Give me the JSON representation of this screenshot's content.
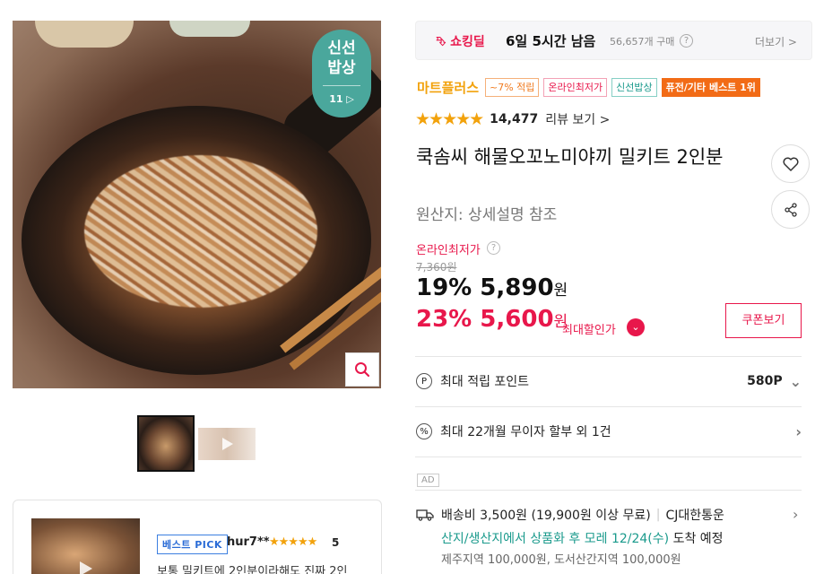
{
  "gallery": {
    "fresh_badge_top": "신선",
    "fresh_badge_bottom": "밥상",
    "fresh_badge_sub": "11",
    "zoom_icon": "search-icon"
  },
  "review_preview": {
    "badge": "베스트 PICK",
    "reviewer": "hur7**",
    "stars": "★★★★★",
    "score": "5",
    "text": "보통 밀키트에 2인분이라해도 진짜 2인"
  },
  "deal": {
    "logo": "쇼킹딜",
    "time_left": "6일 5시간 남음",
    "purchase_count": "56,657개 구매",
    "help": "?",
    "more": "더보기 >"
  },
  "brand": "마트플러스",
  "tags": [
    "~7% 적립",
    "온라인최저가",
    "신선밥상",
    "퓨전/기타 베스트 1위"
  ],
  "rating": {
    "stars": "★★★★★",
    "count": "14,477",
    "link": "리뷰 보기 >"
  },
  "product": {
    "title": "쿡솜씨 해물오꼬노미야끼 밀키트 2인분",
    "origin": "원산지: 상세설명 참조"
  },
  "price": {
    "lowest_label": "온라인최저가",
    "original": "7,360원",
    "discount1_rate": "19%",
    "discount1_price": "5,890",
    "unit": "원",
    "discount2_rate": "23%",
    "discount2_price": "5,600",
    "max_discount_label": "최대할인가",
    "coupon_button": "쿠폰보기"
  },
  "benefits": {
    "points_icon": "P",
    "points_label": "최대 적립 포인트",
    "points_value": "580P",
    "installment_icon": "%",
    "installment_label": "최대 22개월 무이자 할부 외 1건"
  },
  "ad_label": "AD",
  "shipping": {
    "fee": "배송비 3,500원 (19,900원 이상 무료)",
    "carrier": "CJ대한통운",
    "date_highlight": "산지/생산지에서 상품화 후 모레 12/24(수)",
    "date_suffix": "도착 예정",
    "extra": "제주지역 100,000원, 도서산간지역 100,000원"
  },
  "colors": {
    "accent_red": "#e8174b",
    "star_gold": "#f2a20c",
    "teal": "#1a9a8c",
    "orange": "#f26b16"
  }
}
